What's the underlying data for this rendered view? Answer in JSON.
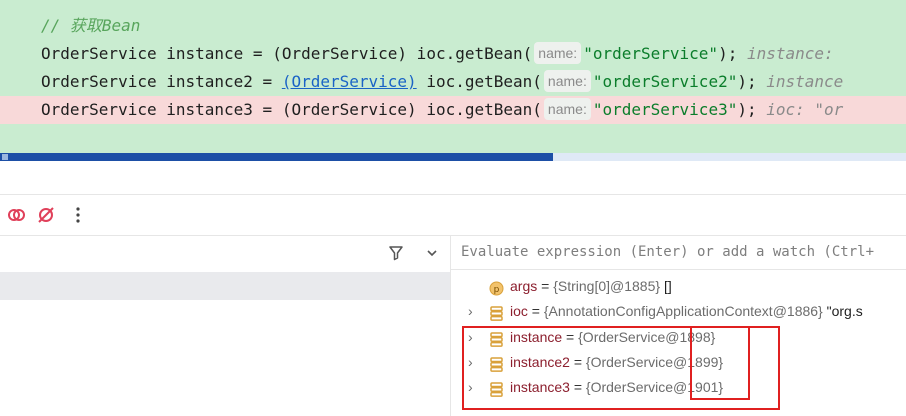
{
  "editor": {
    "comment": "// 获取Bean",
    "lines": [
      {
        "prefix": "OrderService instance = ",
        "cast": "(OrderService)",
        "call": " ioc.getBean(",
        "hint": "name:",
        "arg": "\"orderService\"",
        "suffix": ");",
        "inline": "instance: "
      },
      {
        "prefix": "OrderService instance2 = ",
        "cast": "(OrderService)",
        "call": " ioc.getBean(",
        "hint": "name:",
        "arg": "\"orderService2\"",
        "suffix": ");",
        "inline": "instance"
      },
      {
        "prefix": "OrderService instance3 = ",
        "cast": "(OrderService)",
        "call": " ioc.getBean(",
        "hint": "name:",
        "arg": "\"orderService3\"",
        "suffix": ");",
        "inline": "ioc: \"or"
      }
    ],
    "progress_fraction": 0.61
  },
  "evaluate_placeholder": "Evaluate expression (Enter) or add a watch (Ctrl+",
  "variables": [
    {
      "name": "args",
      "eq": " = ",
      "value": "{String[0]@1885}",
      "extra": " []",
      "icon": "parameter-icon",
      "expandable": false
    },
    {
      "name": "ioc",
      "eq": " = ",
      "value": "{AnnotationConfigApplicationContext@1886}",
      "extra": " \"org.s",
      "icon": "field-icon",
      "expandable": true
    },
    {
      "name": "instance",
      "eq": " = ",
      "value": "{OrderService@1898}",
      "extra": "",
      "icon": "field-icon",
      "expandable": true
    },
    {
      "name": "instance2",
      "eq": " = ",
      "value": "{OrderService@1899}",
      "extra": "",
      "icon": "field-icon",
      "expandable": true
    },
    {
      "name": "instance3",
      "eq": " = ",
      "value": "{OrderService@1901}",
      "extra": "",
      "icon": "field-icon",
      "expandable": true
    }
  ],
  "colors": {
    "code_bg": "#c9ecd0",
    "error_line": "#f8d9d9",
    "string": "#0b7d2b",
    "var_name": "#8c1f2e",
    "highlight": "#e02020",
    "progress": "#1d4fa6"
  }
}
